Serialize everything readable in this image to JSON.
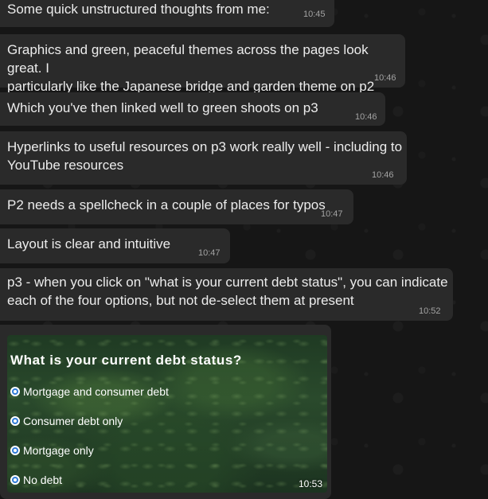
{
  "messages": [
    {
      "text": "Some quick unstructured thoughts from me:",
      "time": "10:45"
    },
    {
      "text": "Graphics and green, peaceful themes across the pages look great. I\nparticularly like the Japanese bridge and garden theme on p2",
      "time": "10:46"
    },
    {
      "text": "Which you've then linked well to green shoots on p3",
      "time": "10:46"
    },
    {
      "text": "Hyperlinks to useful resources on p3 work really well - including to\nYouTube resources",
      "time": "10:46"
    },
    {
      "text": "P2 needs a spellcheck in a couple of places for typos",
      "time": "10:47"
    },
    {
      "text": "Layout is clear and intuitive",
      "time": "10:47"
    },
    {
      "text": "p3 - when you click on \"what is your current debt status\", you can indicate\neach of the four options, but not de-select them at present",
      "time": "10:52"
    }
  ],
  "image_message": {
    "question": "What is your current debt status?",
    "options": [
      "Mortgage and consumer debt",
      "Consumer debt only",
      "Mortgage only",
      "No debt"
    ],
    "time": "10:53"
  },
  "colors": {
    "background": "#161616",
    "bubble": "#2a2a2a",
    "radio_selected": "#2f7bd8"
  }
}
